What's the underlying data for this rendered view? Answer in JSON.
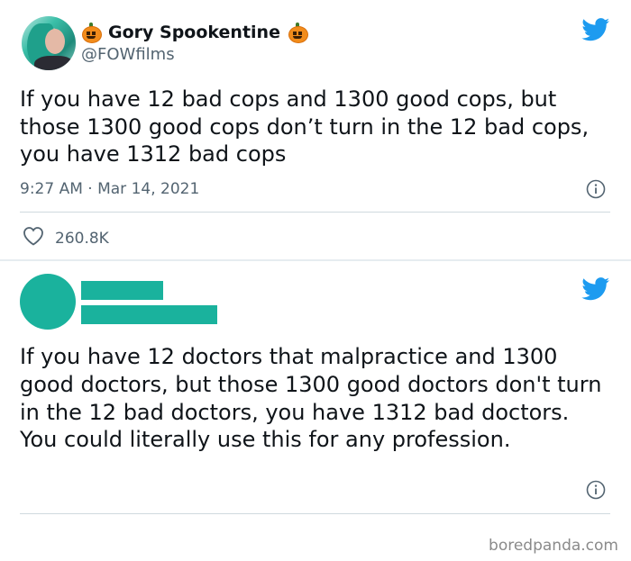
{
  "tweet1": {
    "display_name": "Gory Spookentine",
    "handle": "@FOWfilms",
    "text": "If you have 12 bad cops and 1300 good cops, but those 1300 good cops don’t turn in the 12 bad cops, you have 1312 bad cops",
    "timestamp": "9:27 AM · Mar 14, 2021",
    "likes": "260.8K"
  },
  "tweet2": {
    "text": "If you have 12 doctors that malpractice and 1300 good doctors, but those 1300 good doctors don't turn in the 12 bad doctors, you have 1312 bad doctors. You could literally use this for any profession."
  },
  "watermark": "boredpanda.com",
  "colors": {
    "twitter_blue": "#1d9bf0",
    "redaction": "#1ab29d",
    "secondary_text": "#536471"
  },
  "icons": [
    "twitter-bird-icon",
    "info-icon",
    "heart-icon",
    "pumpkin-emoji-icon"
  ]
}
